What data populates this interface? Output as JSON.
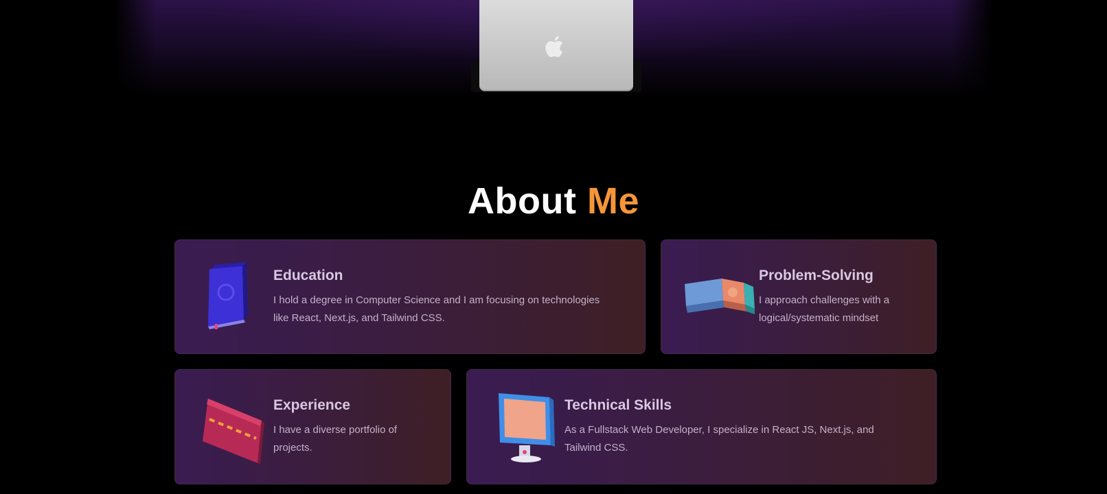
{
  "section": {
    "title_main": "About",
    "title_accent": "Me",
    "accent_color": "#f5963a"
  },
  "hero": {
    "image_icon": "laptop-icon",
    "logo_icon": "apple-logo-icon"
  },
  "cards": {
    "education": {
      "title": "Education",
      "text": "I hold a degree in Computer Science and I am focusing on technologies like React, Next.js, and Tailwind CSS.",
      "icon": "book-icon"
    },
    "problem_solving": {
      "title": "Problem-Solving",
      "text": "I approach challenges with a logical/systematic mindset",
      "icon": "eraser-icon"
    },
    "experience": {
      "title": "Experience",
      "text": "I have a diverse portfolio of projects.",
      "icon": "credit-card-icon"
    },
    "technical_skills": {
      "title": "Technical Skills",
      "text": "As a Fullstack Web Developer, I specialize in React JS, Next.js, and Tailwind CSS.",
      "icon": "computer-monitor-icon"
    }
  }
}
